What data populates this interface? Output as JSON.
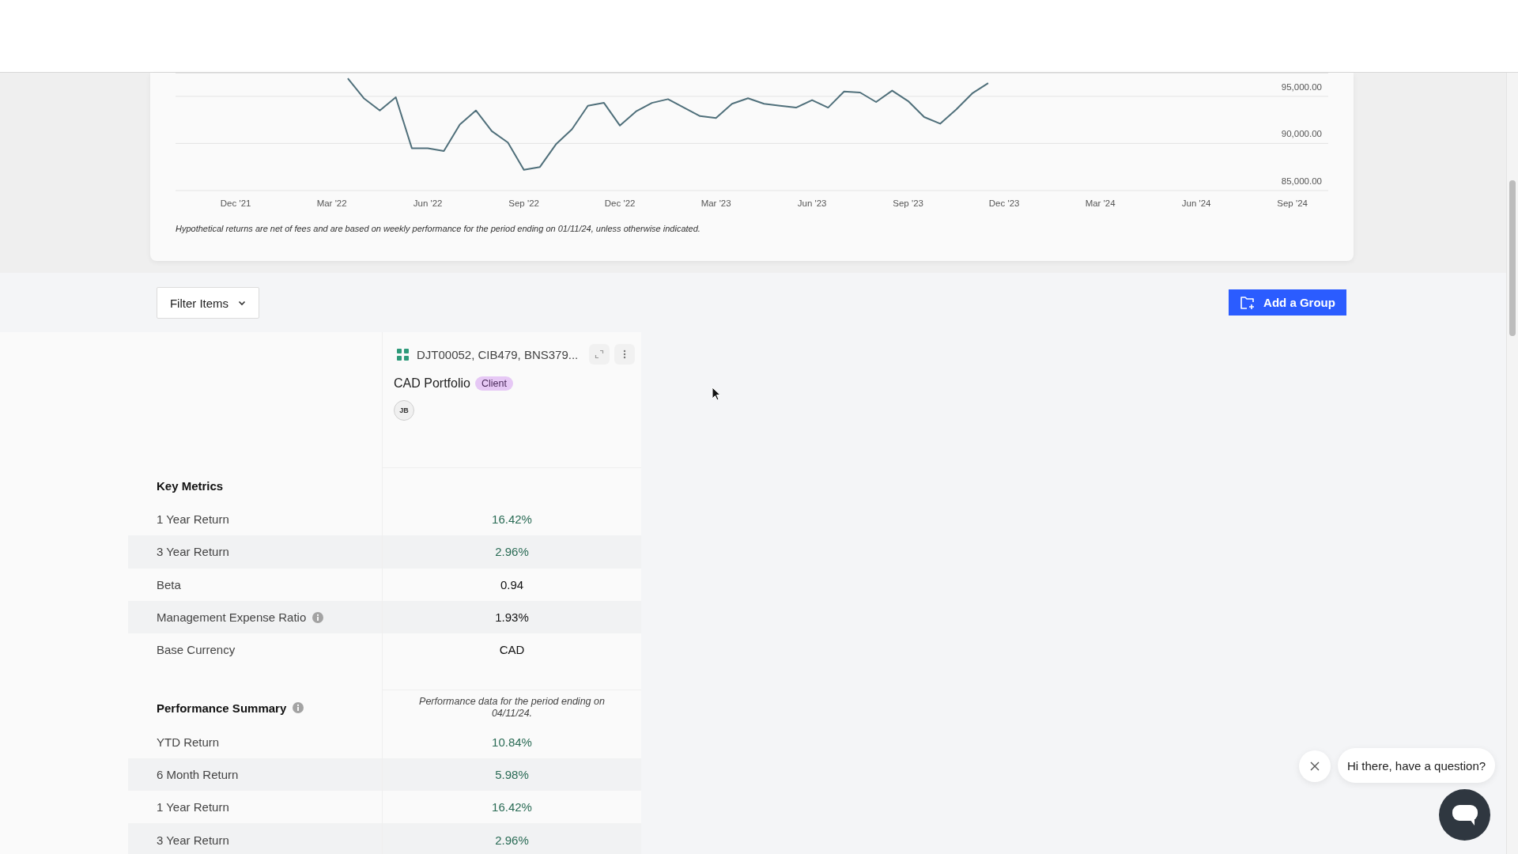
{
  "chart": {
    "chart_data": {
      "type": "line",
      "ylim": [
        85000,
        97500
      ],
      "categories": [
        null,
        null,
        null,
        "Dec '21",
        null,
        null,
        null,
        null,
        null,
        "Mar '22",
        null,
        null,
        null,
        null,
        null,
        "Jun '22",
        null,
        null,
        null,
        null,
        null,
        "Sep '22",
        null,
        null,
        null,
        null,
        null,
        "Dec '22",
        null,
        null,
        null,
        null,
        null,
        "Mar '23",
        null,
        null,
        null,
        null,
        null,
        "Jun '23",
        null,
        null,
        null,
        null,
        null,
        "Sep '23",
        null,
        null,
        null,
        null,
        null,
        "Dec '23",
        null,
        null,
        null,
        null,
        null,
        "Mar '24",
        null,
        null,
        null,
        null,
        null,
        "Jun '24",
        null,
        null,
        null,
        null,
        null,
        "Sep '24",
        null
      ],
      "yticks": [
        {
          "value": 85000,
          "label": "85,000.00"
        },
        {
          "value": 90000,
          "label": "90,000.00"
        },
        {
          "value": 95000,
          "label": "95,000.00"
        }
      ],
      "series": [
        {
          "color": "#4f6f7a",
          "values": [
            null,
            null,
            null,
            null,
            null,
            null,
            null,
            null,
            null,
            null,
            96900,
            94800,
            93500,
            94900,
            89500,
            89500,
            89200,
            92000,
            93500,
            91300,
            90100,
            87200,
            87500,
            89900,
            91500,
            94000,
            94300,
            91900,
            93400,
            94300,
            94700,
            93800,
            92900,
            92700,
            94200,
            94800,
            94200,
            94000,
            93800,
            94600,
            93800,
            95500,
            95400,
            94400,
            95600,
            94500,
            92800,
            92100,
            93600,
            95300,
            96400,
            null,
            null,
            null,
            null,
            null,
            null,
            null,
            null,
            null,
            null,
            null,
            null,
            null,
            null,
            null,
            null,
            null,
            null,
            null,
            null
          ]
        }
      ]
    },
    "footnote": "Hypothetical returns are net of fees and are based on weekly performance for the period ending on 01/11/24, unless otherwise indicated."
  },
  "toolbar": {
    "filter_label": "Filter Items",
    "add_label": "Add a Group"
  },
  "portfolio": {
    "accounts": "DJT00052, CIB479, BNS379...",
    "name": "CAD Portfolio",
    "tag": "Client",
    "avatar": "JB"
  },
  "sections": [
    {
      "title": "Key Metrics",
      "info": false,
      "rows": [
        {
          "label": "1 Year Return",
          "value": "16.42%",
          "color": "#2a6b55",
          "info": false
        },
        {
          "label": "3 Year Return",
          "value": "2.96%",
          "color": "#2a6b55",
          "info": false
        },
        {
          "label": "Beta",
          "value": "0.94",
          "color": "#111111",
          "info": false
        },
        {
          "label": "Management Expense Ratio",
          "value": "1.93%",
          "color": "#111111",
          "info": true
        },
        {
          "label": "Base Currency",
          "value": "CAD",
          "color": "#111111",
          "info": false
        }
      ]
    },
    {
      "title": "Performance Summary",
      "info": true,
      "note": "Performance data for the period ending on 04/11/24.",
      "rows": [
        {
          "label": "YTD Return",
          "value": "10.84%",
          "color": "#2a6b55",
          "info": false
        },
        {
          "label": "6 Month Return",
          "value": "5.98%",
          "color": "#2a6b55",
          "info": false
        },
        {
          "label": "1 Year Return",
          "value": "16.42%",
          "color": "#2a6b55",
          "info": false
        },
        {
          "label": "3 Year Return",
          "value": "2.96%",
          "color": "#2a6b55",
          "info": false
        }
      ]
    }
  ],
  "chat": {
    "message": "Hi there, have a question?"
  }
}
